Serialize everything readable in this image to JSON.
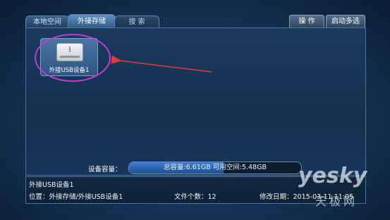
{
  "tabs": [
    {
      "label": "本地空间"
    },
    {
      "label": "外接存储"
    },
    {
      "label": "搜 索"
    }
  ],
  "actions": {
    "operate_label": "操 作",
    "multi_select_label": "启动多选"
  },
  "device": {
    "icon": "usb-drive-icon",
    "name": "外接USB设备1"
  },
  "capacity": {
    "label": "设备容量：",
    "text": "总容量:6.61GB    可用空间:5.48GB",
    "total_gb": 6.61,
    "free_gb": 5.48
  },
  "info": {
    "title": "外接USB设备1",
    "location": "位置：外接存储/外接USB设备1",
    "file_count": "文件个数：12",
    "modified": "修改日期：2015-03-11 11:05"
  },
  "colors": {
    "highlight_ring": "#c33ad8",
    "arrow": "#e23b3b",
    "accent": "#3f7ed0"
  },
  "watermark": {
    "en": "yesky",
    "cn": "天极网"
  }
}
